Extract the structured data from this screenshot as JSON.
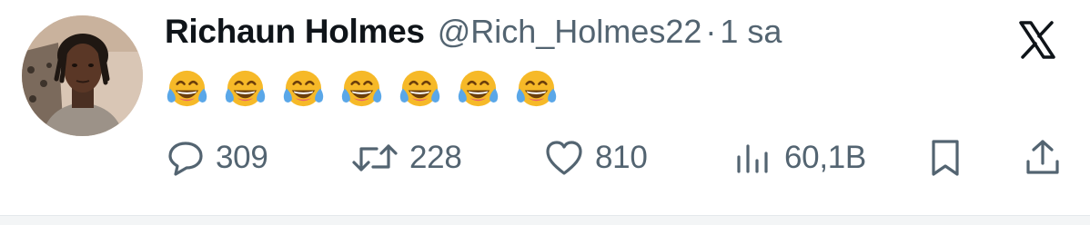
{
  "tweet": {
    "author_name": "Richaun Holmes",
    "handle": "@Rich_Holmes22",
    "separator": "·",
    "time": "1 sa",
    "content_emoji": "😂😂😂😂😂😂😂",
    "emoji_count": 7
  },
  "actions": {
    "replies": "309",
    "retweets": "228",
    "likes": "810",
    "views": "60,1B"
  },
  "icons": {
    "platform": "x-logo-icon",
    "reply": "reply-icon",
    "retweet": "retweet-icon",
    "like": "heart-icon",
    "views": "views-chart-icon",
    "bookmark": "bookmark-icon",
    "share": "share-icon"
  },
  "colors": {
    "text_primary": "#0f1419",
    "text_secondary": "#536471",
    "emoji_face": "#f6b928",
    "emoji_tears": "#5aa7e8"
  }
}
